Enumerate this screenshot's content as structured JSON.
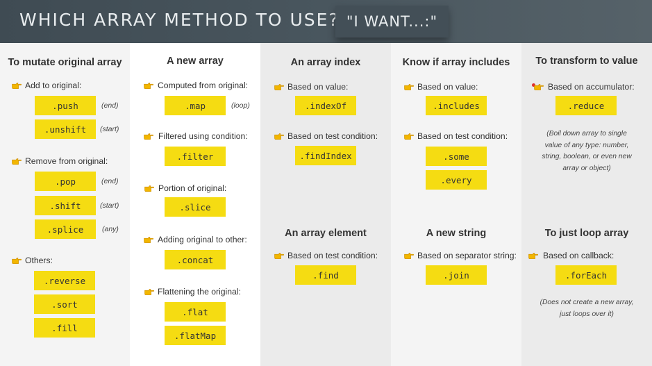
{
  "header": {
    "title": "WHICH ARRAY METHOD TO USE?",
    "thinking_icon": "thinking-face-icon",
    "want": "\"I WANT...:\""
  },
  "colors": {
    "header": "#3f4b53",
    "pill": "#f5dc12",
    "hand": "#f2b600",
    "accent_dot": "#e03030"
  },
  "columns": {
    "c1": {
      "heading": "To mutate original array",
      "g1": {
        "label": "Add to original:",
        "m1": ".push",
        "n1": "(end)",
        "m2": ".unshift",
        "n2": "(start)"
      },
      "g2": {
        "label": "Remove from original:",
        "m1": ".pop",
        "n1": "(end)",
        "m2": ".shift",
        "n2": "(start)",
        "m3": ".splice",
        "n3": "(any)"
      },
      "g3": {
        "label": "Others:",
        "m1": ".reverse",
        "m2": ".sort",
        "m3": ".fill"
      }
    },
    "c2": {
      "heading": "A new array",
      "g1": {
        "label": "Computed from original:",
        "m1": ".map",
        "n1": "(loop)"
      },
      "g2": {
        "label": "Filtered using condition:",
        "m1": ".filter"
      },
      "g3": {
        "label": "Portion of original:",
        "m1": ".slice"
      },
      "g4": {
        "label": "Adding original to other:",
        "m1": ".concat"
      },
      "g5": {
        "label": "Flattening the original:",
        "m1": ".flat",
        "m2": ".flatMap"
      }
    },
    "c3": {
      "heading": "An array index",
      "g1": {
        "label": "Based on value:",
        "m1": ".indexOf"
      },
      "g2": {
        "label": "Based on test condition:",
        "m1": ".findIndex"
      },
      "heading2": "An array element",
      "g3": {
        "label": "Based on test condition:",
        "m1": ".find"
      }
    },
    "c4": {
      "heading": "Know if array includes",
      "g1": {
        "label": "Based on value:",
        "m1": ".includes"
      },
      "g2": {
        "label": "Based on test condition:",
        "m1": ".some",
        "m2": ".every"
      },
      "heading2": "A new string",
      "g3": {
        "label": "Based on separator string:",
        "m1": ".join"
      }
    },
    "c5": {
      "heading": "To transform to value",
      "g1": {
        "label": "Based on accumulator:",
        "m1": ".reduce"
      },
      "desc1": "(Boil down array to single value of any type: number, string, boolean, or even new array or object)",
      "heading2": "To just loop array",
      "g2": {
        "label": "Based on callback:",
        "m1": ".forEach"
      },
      "desc2": "(Does not create a new array, just loops over it)"
    }
  }
}
